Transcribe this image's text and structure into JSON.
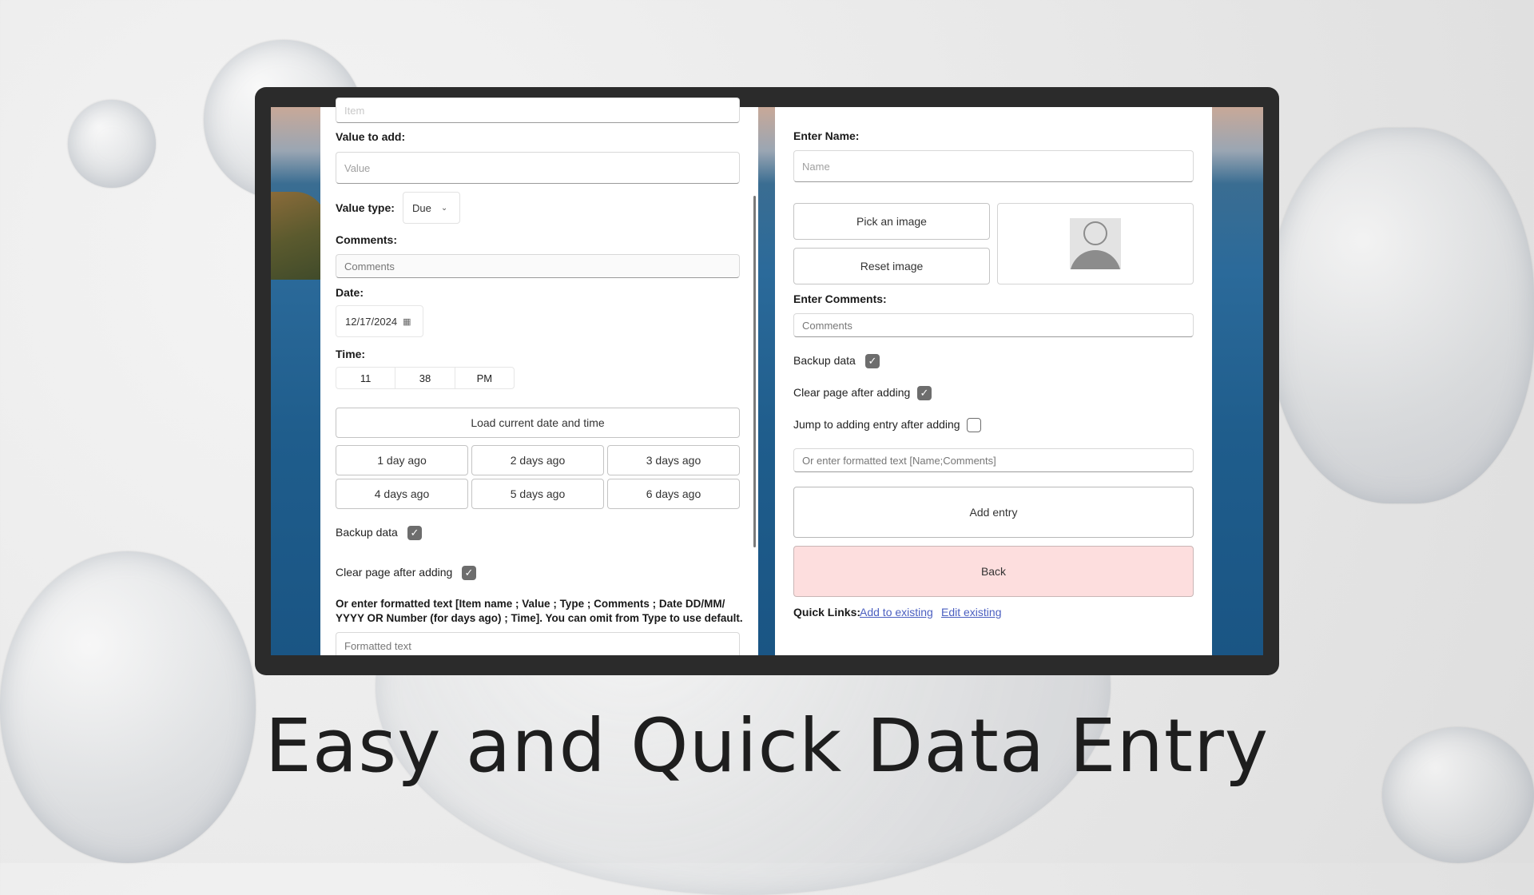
{
  "headline": "Easy and Quick Data Entry",
  "left": {
    "item_placeholder": "Item",
    "value_label": "Value to add:",
    "value_placeholder": "Value",
    "value_type_label": "Value type:",
    "value_type_selected": "Due",
    "comments_label": "Comments:",
    "comments_placeholder": "Comments",
    "date_label": "Date:",
    "date_value": "12/17/2024",
    "time_label": "Time:",
    "time_hour": "11",
    "time_minute": "38",
    "time_period": "PM",
    "load_current_label": "Load current date and time",
    "days_ago": [
      "1 day ago",
      "2 days ago",
      "3 days ago",
      "4 days ago",
      "5 days ago",
      "6 days ago"
    ],
    "backup_label": "Backup data",
    "clear_label": "Clear page after adding",
    "formatted_instructions_1": "Or enter formatted text [Item name ; Value ; Type ; Comments ; Date DD/MM/",
    "formatted_instructions_2": "YYYY OR Number (for days ago) ; Time]. You can omit from Type to use default.",
    "formatted_placeholder": "Formatted text"
  },
  "right": {
    "name_label": "Enter Name:",
    "name_placeholder": "Name",
    "pick_image_label": "Pick an image",
    "reset_image_label": "Reset image",
    "comments_label": "Enter Comments:",
    "comments_placeholder": "Comments",
    "backup_label": "Backup data",
    "clear_label": "Clear page after adding",
    "jump_label": "Jump to adding entry after adding",
    "formatted_placeholder": "Or enter formatted text [Name;Comments]",
    "add_entry_label": "Add entry",
    "back_label": "Back",
    "quick_links_label": "Quick Links:",
    "link_add_existing": "Add to existing",
    "link_edit_existing": "Edit existing"
  },
  "colors": {
    "back_button_bg": "#fddede",
    "link": "#4b5fc0",
    "checkbox": "#6d6d6d"
  }
}
